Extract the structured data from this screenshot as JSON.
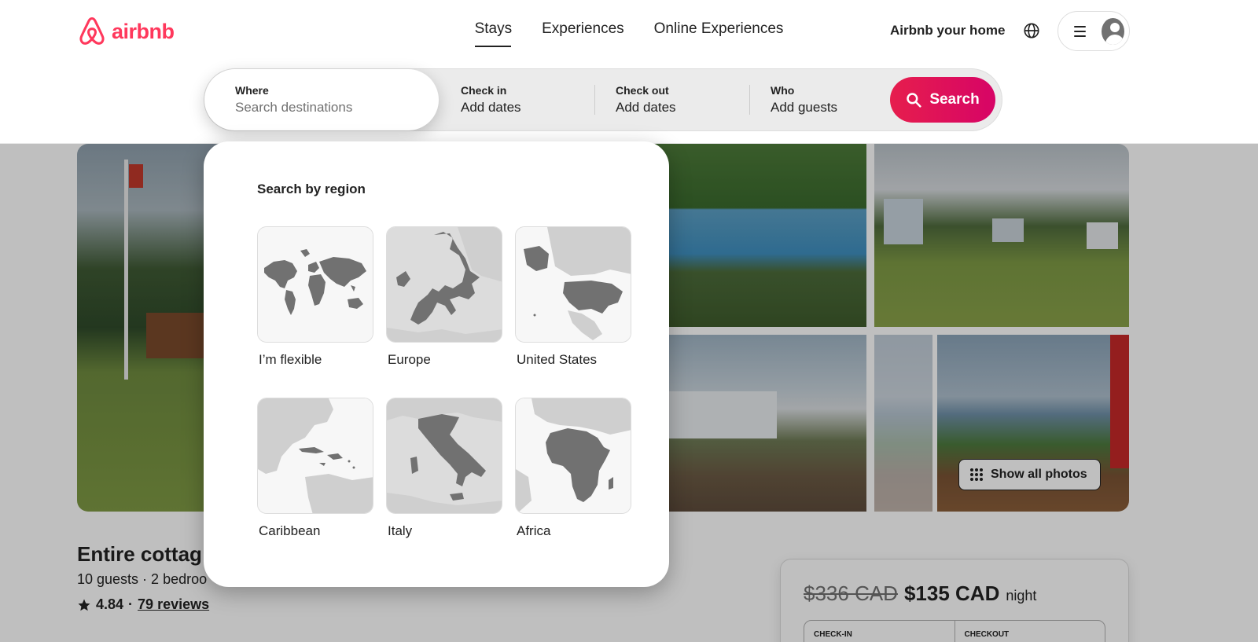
{
  "brand": {
    "name": "airbnb",
    "color": "#ff385c"
  },
  "nav": {
    "items": [
      {
        "label": "Stays",
        "active": true
      },
      {
        "label": "Experiences",
        "active": false
      },
      {
        "label": "Online Experiences",
        "active": false
      }
    ],
    "host_link": "Airbnb your home",
    "globe_icon": "globe-icon",
    "menu_icon": "hamburger-icon",
    "avatar_icon": "user-avatar-icon"
  },
  "search": {
    "where": {
      "label": "Where",
      "placeholder": "Search destinations"
    },
    "check_in": {
      "label": "Check in",
      "value": "Add dates"
    },
    "check_out": {
      "label": "Check out",
      "value": "Add dates"
    },
    "who": {
      "label": "Who",
      "value": "Add guests"
    },
    "button_label": "Search",
    "button_color": "#e61e4d"
  },
  "region_dropdown": {
    "title": "Search by region",
    "regions": [
      {
        "label": "I’m flexible",
        "map": "world"
      },
      {
        "label": "Europe",
        "map": "europe"
      },
      {
        "label": "United States",
        "map": "united-states"
      },
      {
        "label": "Caribbean",
        "map": "caribbean"
      },
      {
        "label": "Italy",
        "map": "italy"
      },
      {
        "label": "Africa",
        "map": "africa"
      }
    ]
  },
  "listing": {
    "title": "Entire cottag",
    "subtitle": "10 guests · 2 bedroo",
    "rating": "4.84",
    "separator": "·",
    "reviews": "79 reviews",
    "show_all_photos": "Show all photos"
  },
  "booking": {
    "old_price": "$336 CAD",
    "price": "$135 CAD",
    "unit": "night",
    "check_in_label": "CHECK-IN",
    "checkout_label": "CHECKOUT"
  }
}
